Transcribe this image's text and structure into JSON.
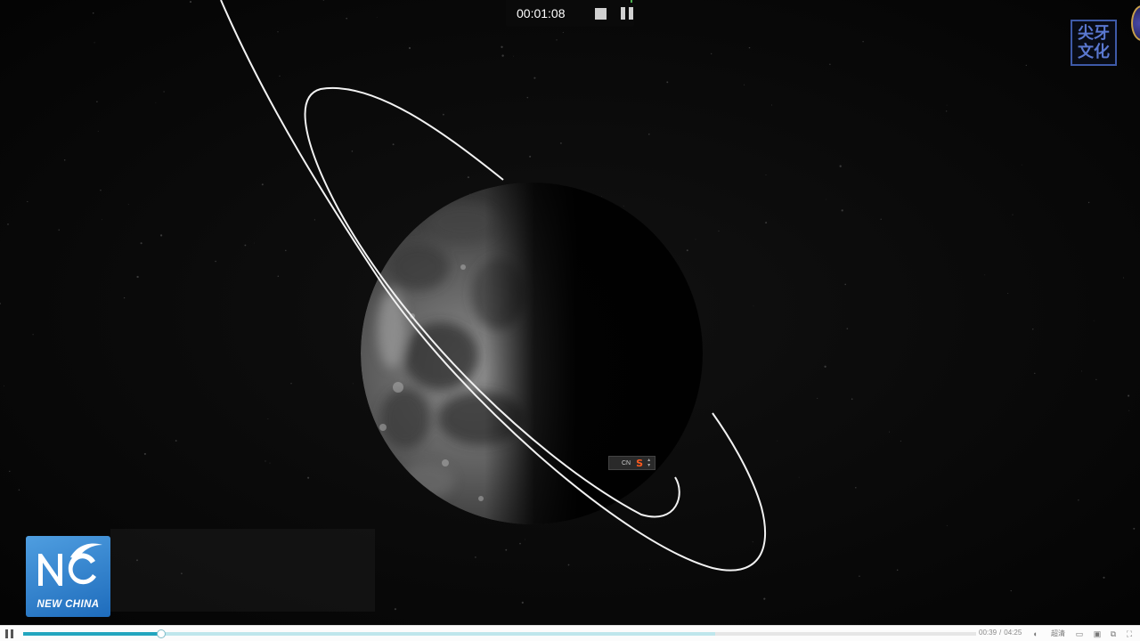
{
  "recorder": {
    "elapsed": "00:01:08",
    "stop_icon": "stop-icon",
    "pause_icon": "pause-icon"
  },
  "watermark": {
    "text_line1": "尖牙",
    "text_line2": "文化"
  },
  "broadcaster_logo": {
    "text": "NEW CHINA"
  },
  "ime_indicator": {
    "lang": "CN",
    "logo_glyph": "S",
    "arrow_up": "▴",
    "arrow_down": "▾"
  },
  "player": {
    "current_time": "00:39",
    "separator": "/",
    "duration": "04:25",
    "played_fraction": 0.145,
    "buffered_fraction": 0.726,
    "quality_label": "超清",
    "icons": [
      "pause-icon",
      "volume-icon",
      "quality-label",
      "danmaku-icon",
      "screenshot-icon",
      "window-icon",
      "fullscreen-icon",
      "settings-icon"
    ]
  },
  "colors": {
    "progress_played": "#23a6bf",
    "progress_buffered": "#bfe6ec",
    "logo_blue": "#2f83d0",
    "watermark_blue": "#3e5aa8"
  }
}
